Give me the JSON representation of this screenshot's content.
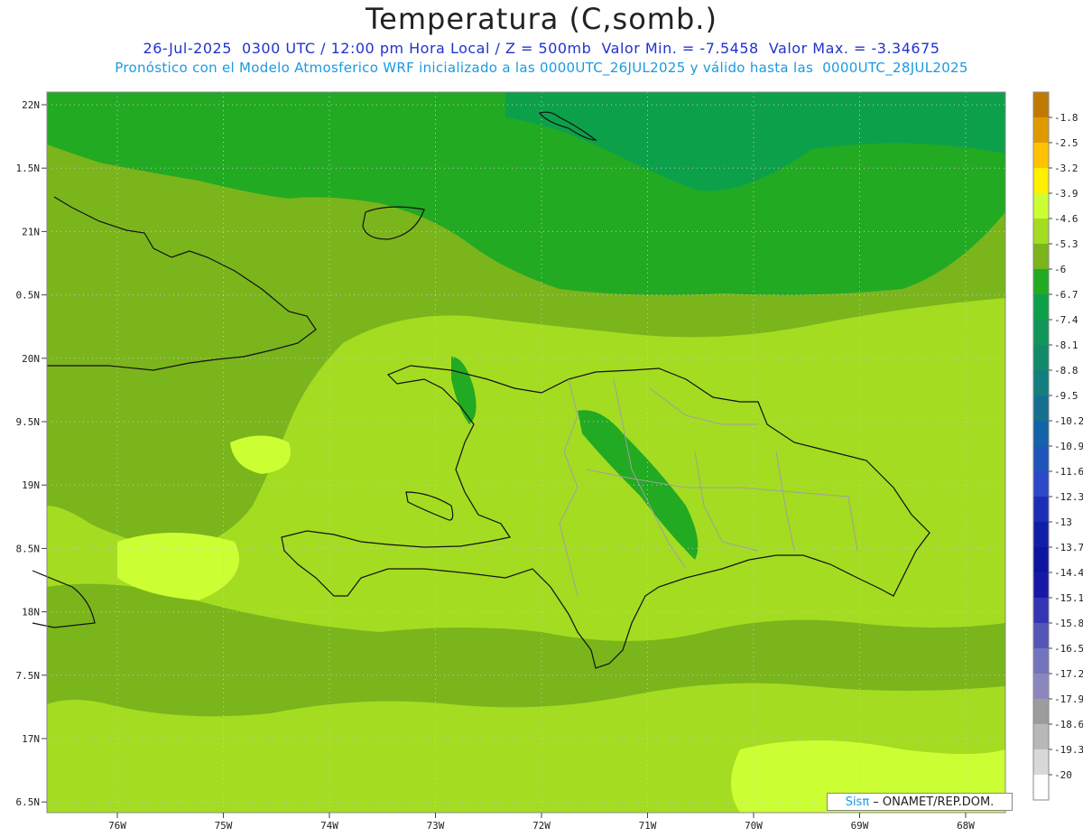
{
  "title": "Temperatura (C,somb.)",
  "subtitle1": "26-Jul-2025  0300 UTC / 12:00 pm Hora Local / Z = 500mb  Valor Min. = -7.5458  Valor Max. = -3.34675",
  "subtitle2": "Pronóstico con el Modelo Atmosferico WRF inicializado a las 0000UTC_26JUL2025 y válido hasta las  0000UTC_28JUL2025",
  "credit": {
    "brand": "Sisπ",
    "text": " – ONAMET/REP.DOM."
  },
  "lat_ticks": [
    "22N",
    "1.5N",
    "21N",
    "0.5N",
    "20N",
    "9.5N",
    "19N",
    "8.5N",
    "18N",
    "7.5N",
    "17N",
    "6.5N"
  ],
  "lon_ticks": [
    "76W",
    "75W",
    "74W",
    "73W",
    "72W",
    "71W",
    "70W",
    "69W",
    "68W"
  ],
  "colorbar": {
    "labels": [
      "-1.8",
      "-2.5",
      "-3.2",
      "-3.9",
      "-4.6",
      "-5.3",
      "-6",
      "-6.7",
      "-7.4",
      "-8.1",
      "-8.8",
      "-9.5",
      "-10.2",
      "-10.9",
      "-11.6",
      "-12.3",
      "-13",
      "-13.7",
      "-14.4",
      "-15.1",
      "-15.8",
      "-16.5",
      "-17.2",
      "-17.9",
      "-18.6",
      "-19.3",
      "-20"
    ],
    "colors": [
      "#c07a00",
      "#e09a00",
      "#ffc200",
      "#ffef00",
      "#ccff33",
      "#a4dc22",
      "#7ab51c",
      "#22aa22",
      "#0da04a",
      "#10965a",
      "#128a6a",
      "#137e7e",
      "#157090",
      "#1462a8",
      "#1f55bb",
      "#2a48c8",
      "#1c2eb8",
      "#101ea8",
      "#0c14a0",
      "#1818a8",
      "#3434b4",
      "#5456b8",
      "#7474bc",
      "#8c86be",
      "#9c9c9c",
      "#b8b8b8",
      "#d8d8d8",
      "#ffffff"
    ]
  },
  "colors": {
    "land_outline": "#111111",
    "province_lines": "#a0a0a0",
    "grid": "#c8c8c8"
  }
}
